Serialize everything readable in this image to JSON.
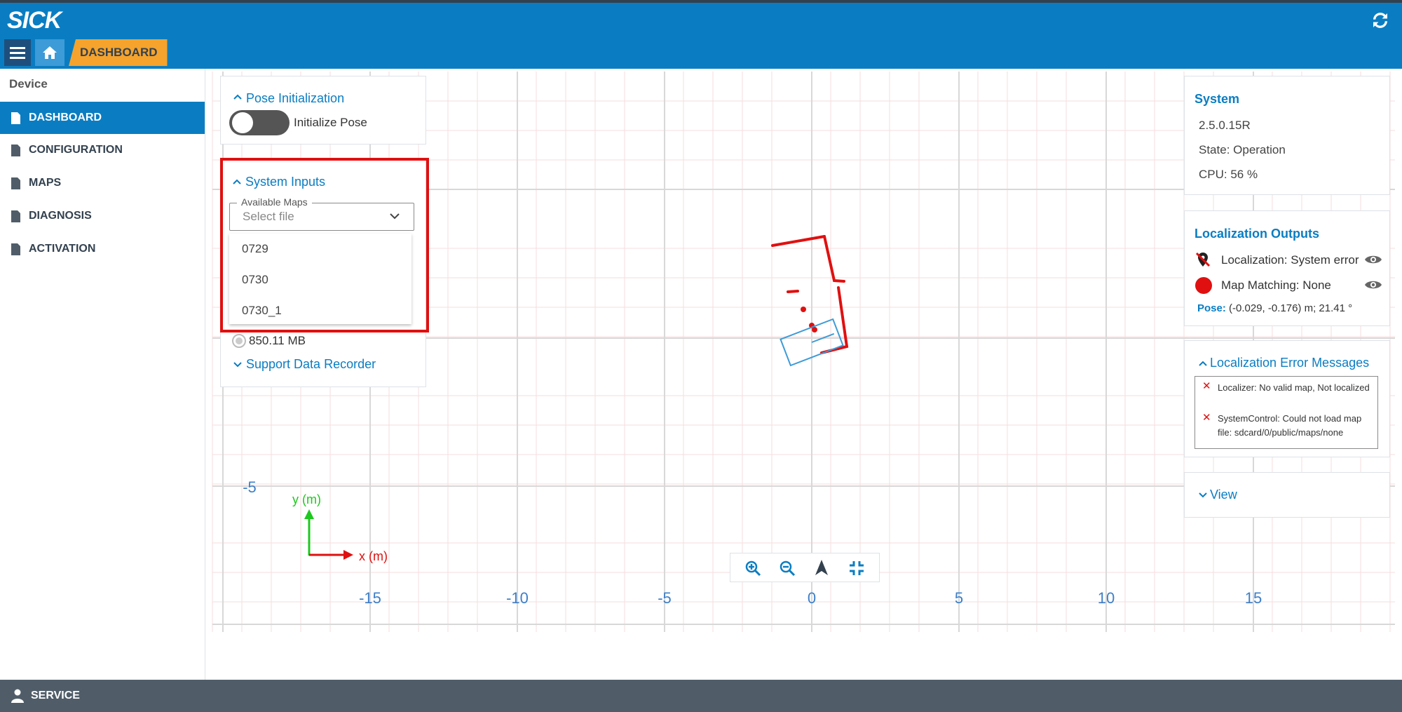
{
  "header": {
    "logo": "SICK",
    "breadcrumb_current": "DASHBOARD"
  },
  "sidebar": {
    "title": "Device",
    "items": [
      {
        "label": "DASHBOARD",
        "active": true
      },
      {
        "label": "CONFIGURATION",
        "active": false
      },
      {
        "label": "MAPS",
        "active": false
      },
      {
        "label": "DIAGNOSIS",
        "active": false
      },
      {
        "label": "ACTIVATION",
        "active": false
      }
    ]
  },
  "footer": {
    "label": "SERVICE"
  },
  "pose_panel": {
    "title": "Pose Initialization",
    "toggle_label": "Initialize Pose",
    "toggle_on": false
  },
  "inputs_panel": {
    "title": "System Inputs",
    "field_label": "Available Maps",
    "placeholder": "Select file",
    "options": [
      "0729",
      "0730",
      "0730_1"
    ],
    "storage": "850.11 MB",
    "recorder_title": "Support Data Recorder"
  },
  "system_panel": {
    "title": "System",
    "version": "2.5.0.15R",
    "state": "State: Operation",
    "cpu": "CPU: 56 %"
  },
  "outputs_panel": {
    "title": "Localization Outputs",
    "localization": "Localization: System error",
    "map_matching": "Map Matching: None",
    "pose_label": "Pose:",
    "pose_value": "(-0.029, -0.176) m; 21.41 °",
    "status_color": "#e01010"
  },
  "errors_panel": {
    "title": "Localization Error Messages",
    "messages": [
      "Localizer: No valid map, Not localized",
      "SystemControl: Could not load map file: sdcard/0/public/maps/none"
    ]
  },
  "view_panel": {
    "title": "View"
  },
  "plot": {
    "x_ticks": [
      "-15",
      "-10",
      "-5",
      "0",
      "5",
      "10",
      "15"
    ],
    "y_tick": "-5",
    "x_axis_label": "x (m)",
    "y_axis_label": "y (m)",
    "accent": "#0a7dc2",
    "scan_color": "#e01010"
  }
}
